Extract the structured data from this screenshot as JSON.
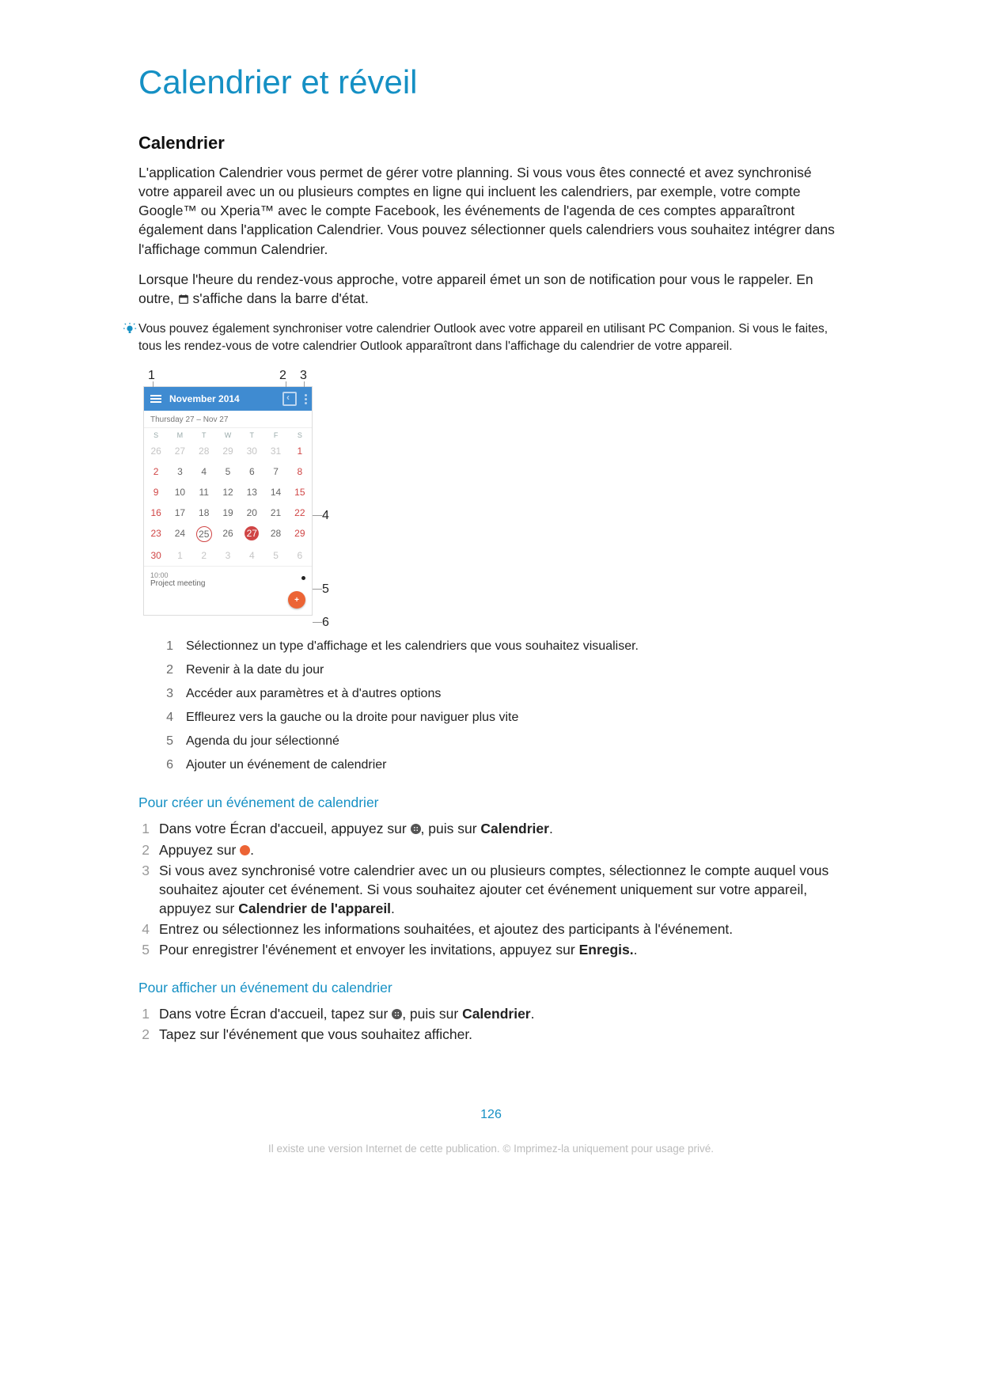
{
  "title": "Calendrier et réveil",
  "h2": "Calendrier",
  "para1": "L'application Calendrier vous permet de gérer votre planning. Si vous vous êtes connecté et avez synchronisé votre appareil avec un ou plusieurs comptes en ligne qui incluent les calendriers, par exemple, votre compte Google™ ou Xperia™ avec le compte Facebook, les événements de l'agenda de ces comptes apparaîtront également dans l'application Calendrier. Vous pouvez sélectionner quels calendriers vous souhaitez intégrer dans l'affichage commun Calendrier.",
  "para2a": "Lorsque l'heure du rendez-vous approche, votre appareil émet un son de notification pour vous le rappeler. En outre, ",
  "para2b": "s'affiche dans la barre d'état.",
  "hint": "Vous pouvez également synchroniser votre calendrier Outlook avec votre appareil en utilisant PC Companion. Si vous le faites, tous les rendez-vous de votre calendrier Outlook apparaîtront dans l'affichage du calendrier de votre appareil.",
  "calendar": {
    "month": "November 2014",
    "weekname": "Thursday 27 – Nov 27",
    "dow": [
      "S",
      "M",
      "T",
      "W",
      "T",
      "F",
      "S"
    ],
    "rows": [
      {
        "cells": [
          {
            "v": "26",
            "cls": "faded"
          },
          {
            "v": "27",
            "cls": "faded"
          },
          {
            "v": "28",
            "cls": "faded"
          },
          {
            "v": "29",
            "cls": "faded"
          },
          {
            "v": "30",
            "cls": "faded"
          },
          {
            "v": "31",
            "cls": "faded"
          },
          {
            "v": "1",
            "cls": "we"
          }
        ]
      },
      {
        "cells": [
          {
            "v": "2",
            "cls": "we"
          },
          {
            "v": "3"
          },
          {
            "v": "4"
          },
          {
            "v": "5"
          },
          {
            "v": "6"
          },
          {
            "v": "7"
          },
          {
            "v": "8",
            "cls": "we"
          }
        ]
      },
      {
        "cells": [
          {
            "v": "9",
            "cls": "we"
          },
          {
            "v": "10"
          },
          {
            "v": "11"
          },
          {
            "v": "12"
          },
          {
            "v": "13"
          },
          {
            "v": "14"
          },
          {
            "v": "15",
            "cls": "we"
          }
        ]
      },
      {
        "cells": [
          {
            "v": "16",
            "cls": "we"
          },
          {
            "v": "17"
          },
          {
            "v": "18"
          },
          {
            "v": "19"
          },
          {
            "v": "20"
          },
          {
            "v": "21"
          },
          {
            "v": "22",
            "cls": "we"
          }
        ]
      },
      {
        "cells": [
          {
            "v": "23",
            "cls": "we"
          },
          {
            "v": "24"
          },
          {
            "v": "25",
            "cls": "today"
          },
          {
            "v": "26"
          },
          {
            "v": "27",
            "cls": "selected"
          },
          {
            "v": "28"
          },
          {
            "v": "29",
            "cls": "we"
          }
        ]
      },
      {
        "cells": [
          {
            "v": "30",
            "cls": "we"
          },
          {
            "v": "1",
            "cls": "faded"
          },
          {
            "v": "2",
            "cls": "faded"
          },
          {
            "v": "3",
            "cls": "faded"
          },
          {
            "v": "4",
            "cls": "faded"
          },
          {
            "v": "5",
            "cls": "faded"
          },
          {
            "v": "6",
            "cls": "faded"
          }
        ]
      }
    ],
    "agenda_time": "10:00",
    "agenda_title": "Project meeting",
    "fab": "+"
  },
  "labels": {
    "l1": "1",
    "l2": "2",
    "l3": "3",
    "l4": "4",
    "l5": "5",
    "l6": "6"
  },
  "legend": [
    {
      "n": "1",
      "t": "Sélectionnez un type d'affichage et les calendriers que vous souhaitez visualiser."
    },
    {
      "n": "2",
      "t": "Revenir à la date du jour"
    },
    {
      "n": "3",
      "t": "Accéder aux paramètres et à d'autres options"
    },
    {
      "n": "4",
      "t": "Effleurez vers la gauche ou la droite pour naviguer plus vite"
    },
    {
      "n": "5",
      "t": "Agenda du jour sélectionné"
    },
    {
      "n": "6",
      "t": "Ajouter un événement de calendrier"
    }
  ],
  "sec1": {
    "title": "Pour créer un événement de calendrier",
    "s1a": "Dans votre Écran d'accueil, appuyez sur ",
    "s1b": ", puis sur ",
    "s1c": "Calendrier",
    "s1d": ".",
    "s2": "Appuyez sur ",
    "s2b": ".",
    "s3a": "Si vous avez synchronisé votre calendrier avec un ou plusieurs comptes, sélectionnez le compte auquel vous souhaitez ajouter cet événement. Si vous souhaitez ajouter cet événement uniquement sur votre appareil, appuyez sur ",
    "s3b": "Calendrier de l'appareil",
    "s3c": ".",
    "s4": "Entrez ou sélectionnez les informations souhaitées, et ajoutez des participants à l'événement.",
    "s5a": "Pour enregistrer l'événement et envoyer les invitations, appuyez sur ",
    "s5b": "Enregis.",
    "s5c": "."
  },
  "sec2": {
    "title": "Pour afficher un événement du calendrier",
    "s1a": "Dans votre Écran d'accueil, tapez sur ",
    "s1b": ", puis sur ",
    "s1c": "Calendrier",
    "s1d": ".",
    "s2": "Tapez sur l'événement que vous souhaitez afficher."
  },
  "page_num": "126",
  "footer": "Il existe une version Internet de cette publication. © Imprimez-la uniquement pour usage privé."
}
